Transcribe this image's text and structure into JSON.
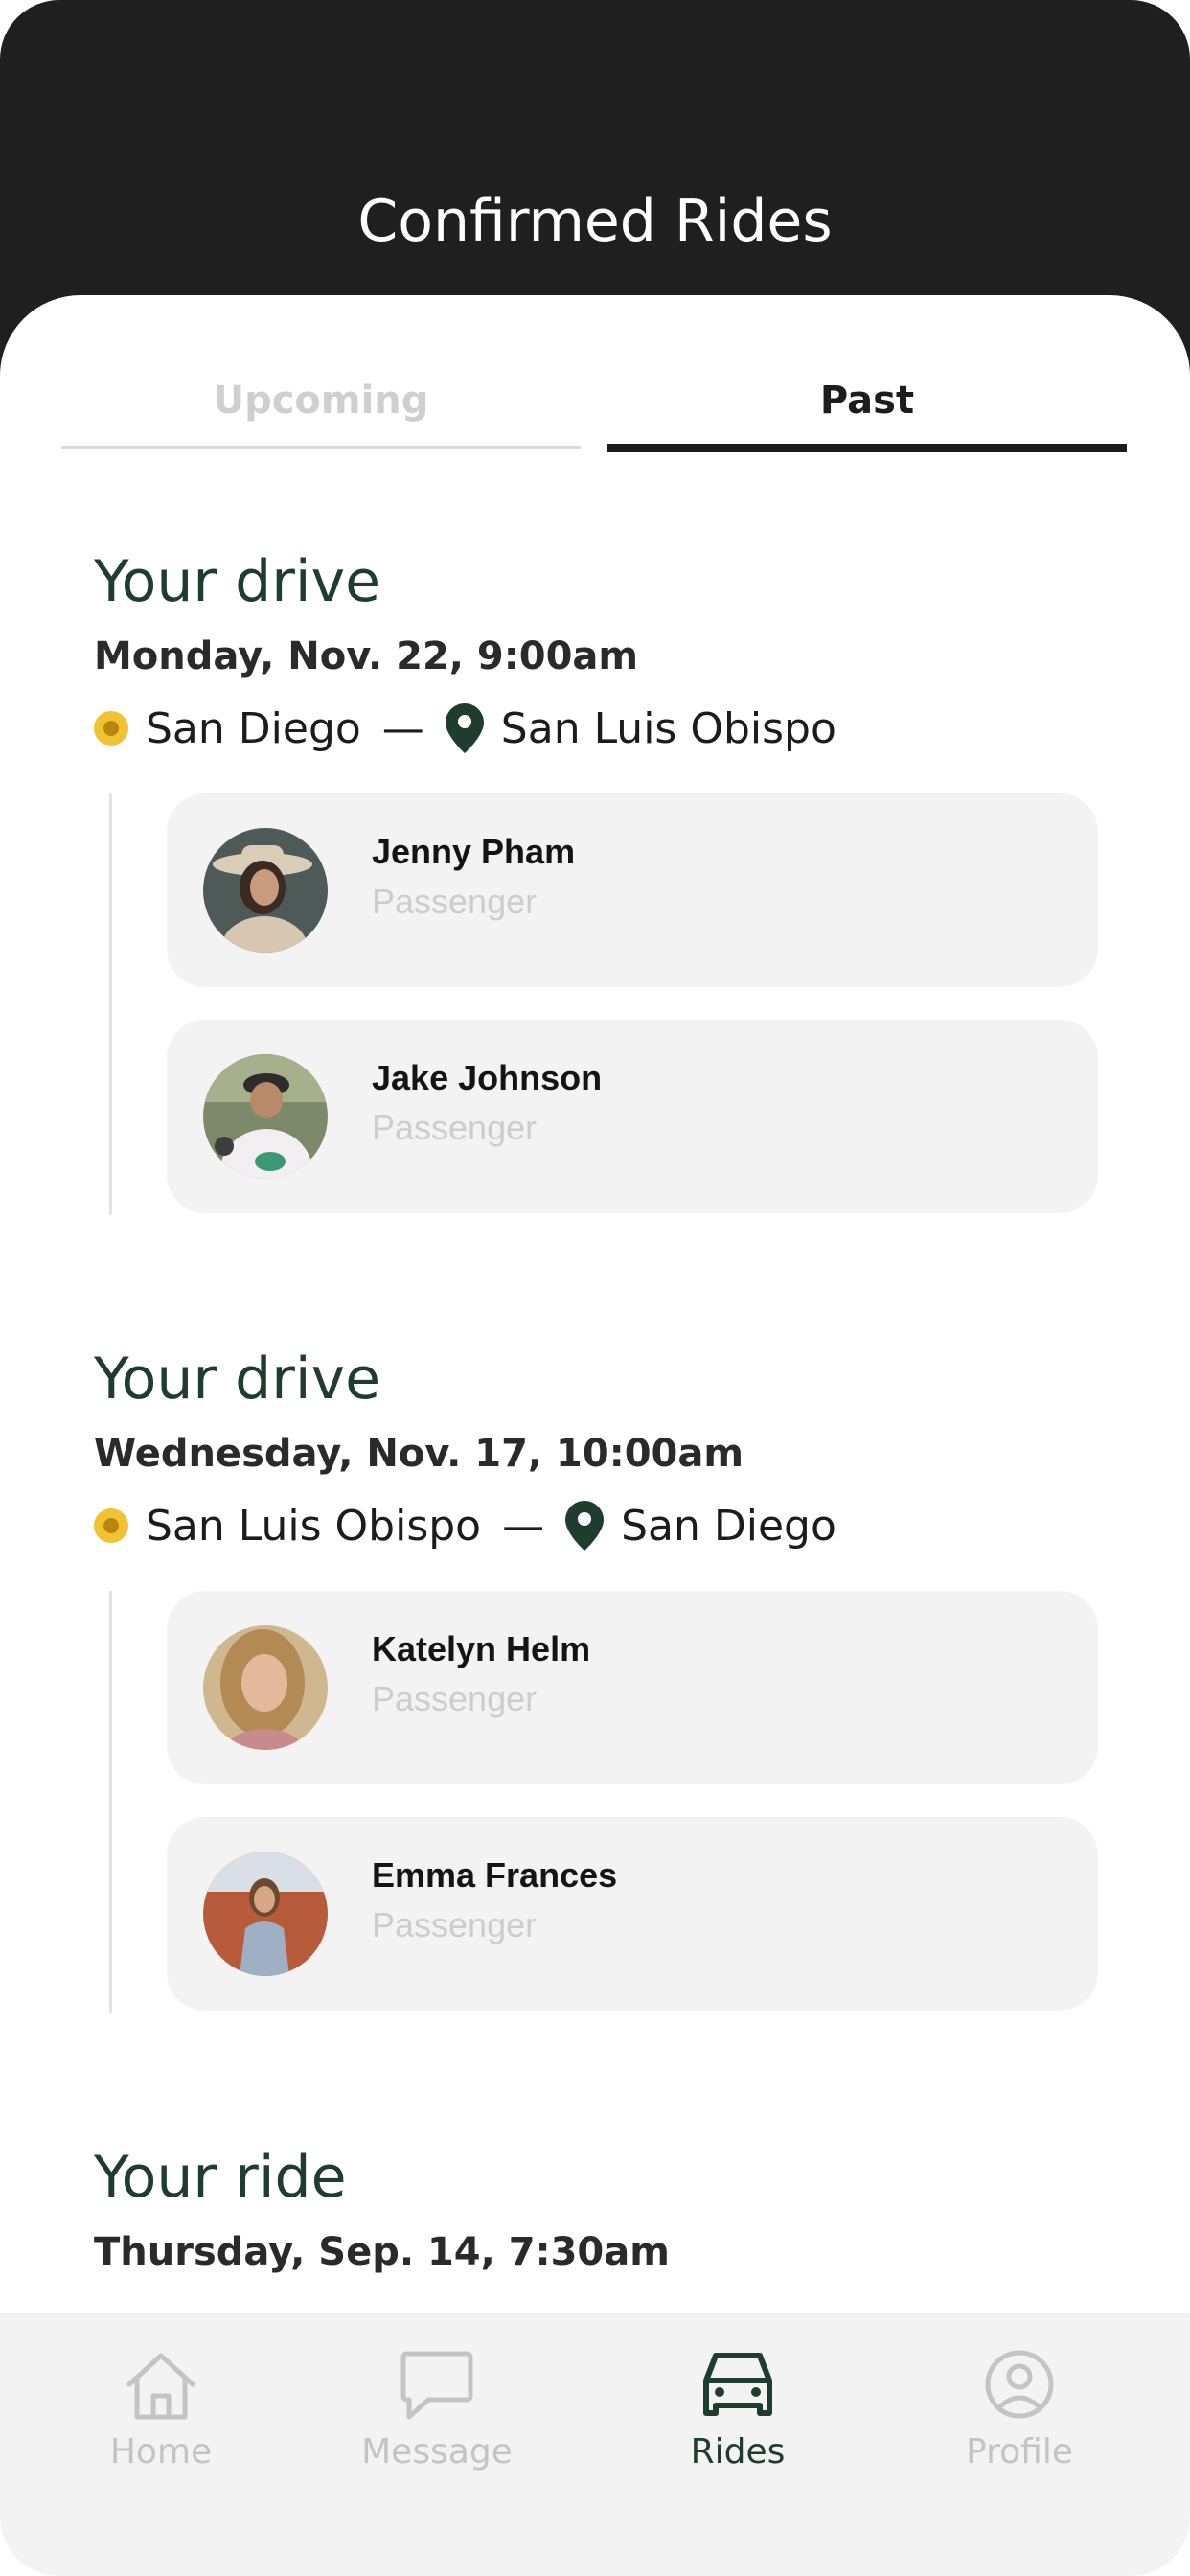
{
  "header": {
    "title": "Confirmed Rides"
  },
  "tabs": {
    "upcoming": "Upcoming",
    "past": "Past",
    "selected": "Past"
  },
  "sections": [
    {
      "title": "Your drive",
      "date": "Monday, Nov. 22, 9:00am",
      "origin": "San Diego",
      "separator": "—",
      "destination": "San Luis Obispo",
      "passengers": [
        {
          "name": "Jenny Pham",
          "role": "Passenger"
        },
        {
          "name": "Jake Johnson",
          "role": "Passenger"
        }
      ]
    },
    {
      "title": "Your drive",
      "date": "Wednesday, Nov. 17, 10:00am",
      "origin": "San Luis Obispo",
      "separator": "—",
      "destination": "San Diego",
      "passengers": [
        {
          "name": "Katelyn Helm",
          "role": "Passenger"
        },
        {
          "name": "Emma Frances",
          "role": "Passenger"
        }
      ]
    },
    {
      "title": "Your ride",
      "date": "Thursday, Sep. 14, 7:30am"
    }
  ],
  "tabbar": {
    "items": [
      {
        "label": "Home",
        "icon": "home-icon"
      },
      {
        "label": "Message",
        "icon": "message-icon"
      },
      {
        "label": "Rides",
        "icon": "car-icon"
      },
      {
        "label": "Profile",
        "icon": "profile-icon"
      }
    ],
    "active": "Rides"
  },
  "colors": {
    "header": "#1f1f1f",
    "accent_green": "#1f3d2f",
    "origin_yellow": "#f1c232",
    "card_bg": "#f3f3f3",
    "muted": "#cdcdcd"
  }
}
